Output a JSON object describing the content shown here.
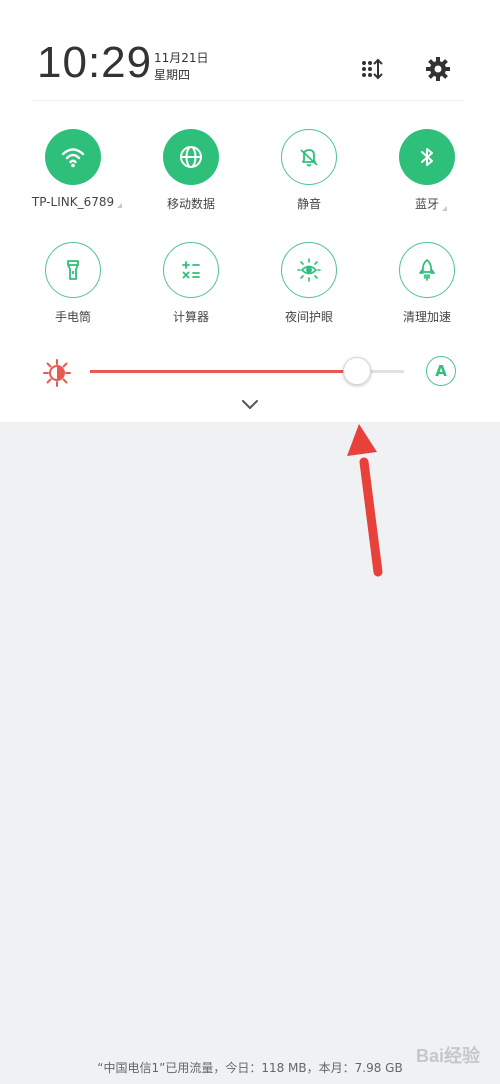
{
  "header": {
    "time": "10:29",
    "date": "11月21日",
    "weekday": "星期四",
    "icons": [
      "edit-tiles-icon",
      "gear-icon"
    ]
  },
  "tiles": [
    {
      "label": "TP-LINK_6789",
      "icon": "wifi-icon",
      "active": true,
      "has_menu": true
    },
    {
      "label": "移动数据",
      "icon": "globe-icon",
      "active": true,
      "has_menu": false
    },
    {
      "label": "静音",
      "icon": "bell-mute-icon",
      "active": false,
      "has_menu": false
    },
    {
      "label": "蓝牙",
      "icon": "bluetooth-icon",
      "active": true,
      "has_menu": true
    },
    {
      "label": "手电筒",
      "icon": "flashlight-icon",
      "active": false,
      "has_menu": false
    },
    {
      "label": "计算器",
      "icon": "calculator-icon",
      "active": false,
      "has_menu": false
    },
    {
      "label": "夜间护眼",
      "icon": "eye-care-icon",
      "active": false,
      "has_menu": false
    },
    {
      "label": "清理加速",
      "icon": "rocket-icon",
      "active": false,
      "has_menu": false
    }
  ],
  "brightness": {
    "level": 0.85,
    "auto_label": "A"
  },
  "footer": {
    "usage_text": "“中国电信1”已用流量，今日：118 MB，本月：7.98 GB"
  },
  "watermark": {
    "text": "Bai经验"
  },
  "colors": {
    "accent": "#2ec07a",
    "brightness_fill": "#e85a4f",
    "arrow": "#e8403a"
  }
}
